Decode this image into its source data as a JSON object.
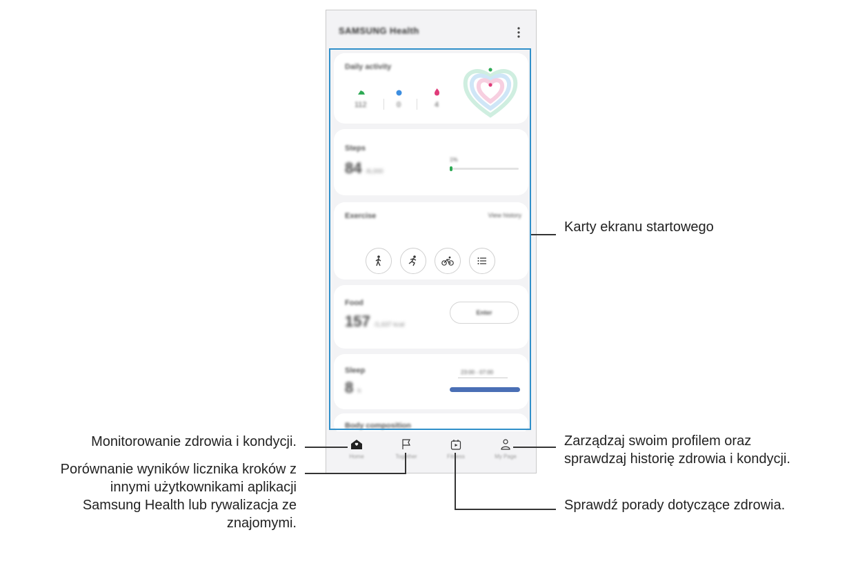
{
  "app": {
    "title": "SAMSUNG Health",
    "more_icon": "more-vert-icon"
  },
  "cards": {
    "daily_activity": {
      "title": "Daily activity",
      "steps": "112",
      "active_minutes": "0",
      "calories": "4"
    },
    "steps": {
      "title": "Steps",
      "value": "84",
      "goal": "/6,000",
      "percent_label": "1%",
      "progress": 0.014
    },
    "exercise": {
      "title": "Exercise",
      "history_link": "View history",
      "buttons": [
        "walking-icon",
        "running-icon",
        "cycling-icon",
        "list-icon"
      ]
    },
    "food": {
      "title": "Food",
      "value": "157",
      "unit": "/1,637 kcal",
      "enter_label": "Enter"
    },
    "sleep": {
      "title": "Sleep",
      "value": "8",
      "unit": "h",
      "time_range": "23:00 - 07:00"
    },
    "body": {
      "title": "Body composition"
    }
  },
  "nav": {
    "items": [
      {
        "label": "Home",
        "icon": "home-icon"
      },
      {
        "label": "Together",
        "icon": "flag-icon"
      },
      {
        "label": "Fitness",
        "icon": "fitness-icon"
      },
      {
        "label": "My Page",
        "icon": "person-icon"
      }
    ]
  },
  "callouts": {
    "cards": "Karty ekranu startowego",
    "home": "Monitorowanie zdrowia i kondycji.",
    "mypage_line1": "Zarządzaj swoim profilem oraz",
    "mypage_line2": "sprawdzaj historię zdrowia i kondycji.",
    "together_line1": "Porównanie wyników licznika kroków z",
    "together_line2": "innymi użytkownikami aplikacji",
    "together_line3": "Samsung Health lub rywalizacja ze",
    "together_line4": "znajomymi.",
    "fitness": "Sprawdź porady dotyczące zdrowia."
  },
  "colors": {
    "accent_frame": "#2f8fc9",
    "steps_green": "#2eaa55",
    "sleep_bar": "#4a6fb5"
  }
}
